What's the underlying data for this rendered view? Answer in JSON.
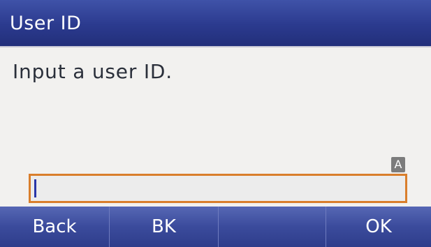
{
  "title_bar": {
    "title": "User ID"
  },
  "prompt": {
    "text": "Input a user ID."
  },
  "input": {
    "mode_indicator": "A",
    "value": ""
  },
  "softkeys": [
    {
      "label": "Back"
    },
    {
      "label": "BK"
    },
    {
      "label": ""
    },
    {
      "label": "OK"
    }
  ],
  "colors": {
    "title_bar": "#2b3a8e",
    "softkey_bar": "#3b4b9c",
    "input_border": "#d97e2c",
    "caret": "#2a36a8",
    "background": "#f2f1ef"
  }
}
